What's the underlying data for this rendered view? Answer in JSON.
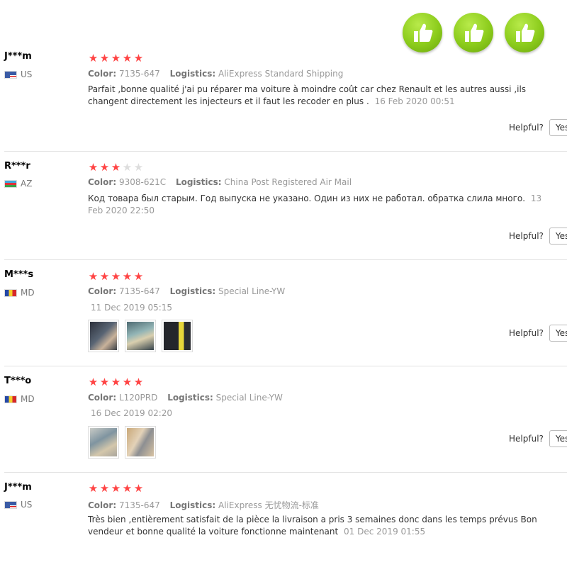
{
  "thumbs": [
    {
      "icon": "thumbs-up-icon"
    },
    {
      "icon": "thumbs-up-icon"
    },
    {
      "icon": "thumbs-up-icon"
    }
  ],
  "labels": {
    "color": "Color:",
    "logistics": "Logistics:",
    "helpful": "Helpful?",
    "yes": "Yes"
  },
  "reviews": [
    {
      "user": "J***m",
      "country": "US",
      "rating": 5,
      "color_value": "7135-647",
      "logistics_value": "AliExpress Standard Shipping",
      "text": "Parfait ,bonne qualité j'ai pu réparer ma voiture à moindre coût car chez Renault et les autres aussi ,ils changent directement les injecteurs et il faut les recoder en plus .",
      "date": "16 Feb 2020 00:51"
    },
    {
      "user": "R***r",
      "country": "AZ",
      "rating": 3,
      "color_value": "9308-621C",
      "logistics_value": "China Post Registered Air Mail",
      "text": "Код товара был старым. Год выпуска не указано. Один из них не работал. обратка слила много.",
      "date": "13 Feb 2020 22:50"
    },
    {
      "user": "M***s",
      "country": "MD",
      "rating": 5,
      "color_value": "7135-647",
      "logistics_value": "Special Line-YW",
      "date": "11 Dec 2019 05:15",
      "photo_count": 3
    },
    {
      "user": "T***o",
      "country": "MD",
      "rating": 5,
      "color_value": "L120PRD",
      "logistics_value": "Special Line-YW",
      "date": "16 Dec 2019 02:20",
      "photo_count": 2
    },
    {
      "user": "J***m",
      "country": "US",
      "rating": 5,
      "color_value": "7135-647",
      "logistics_value": "AliExpress 无忧物流-标准",
      "text": "Très bien ,entièrement satisfait de la pièce la livraison a pris 3 semaines donc dans les temps prévus Bon vendeur et bonne qualité la voiture fonctionne maintenant",
      "date": "01 Dec 2019 01:55"
    }
  ],
  "colors": {
    "star_on": "#ff4444",
    "star_off": "#dddddd",
    "thumb_green": "#8ccc1c"
  }
}
